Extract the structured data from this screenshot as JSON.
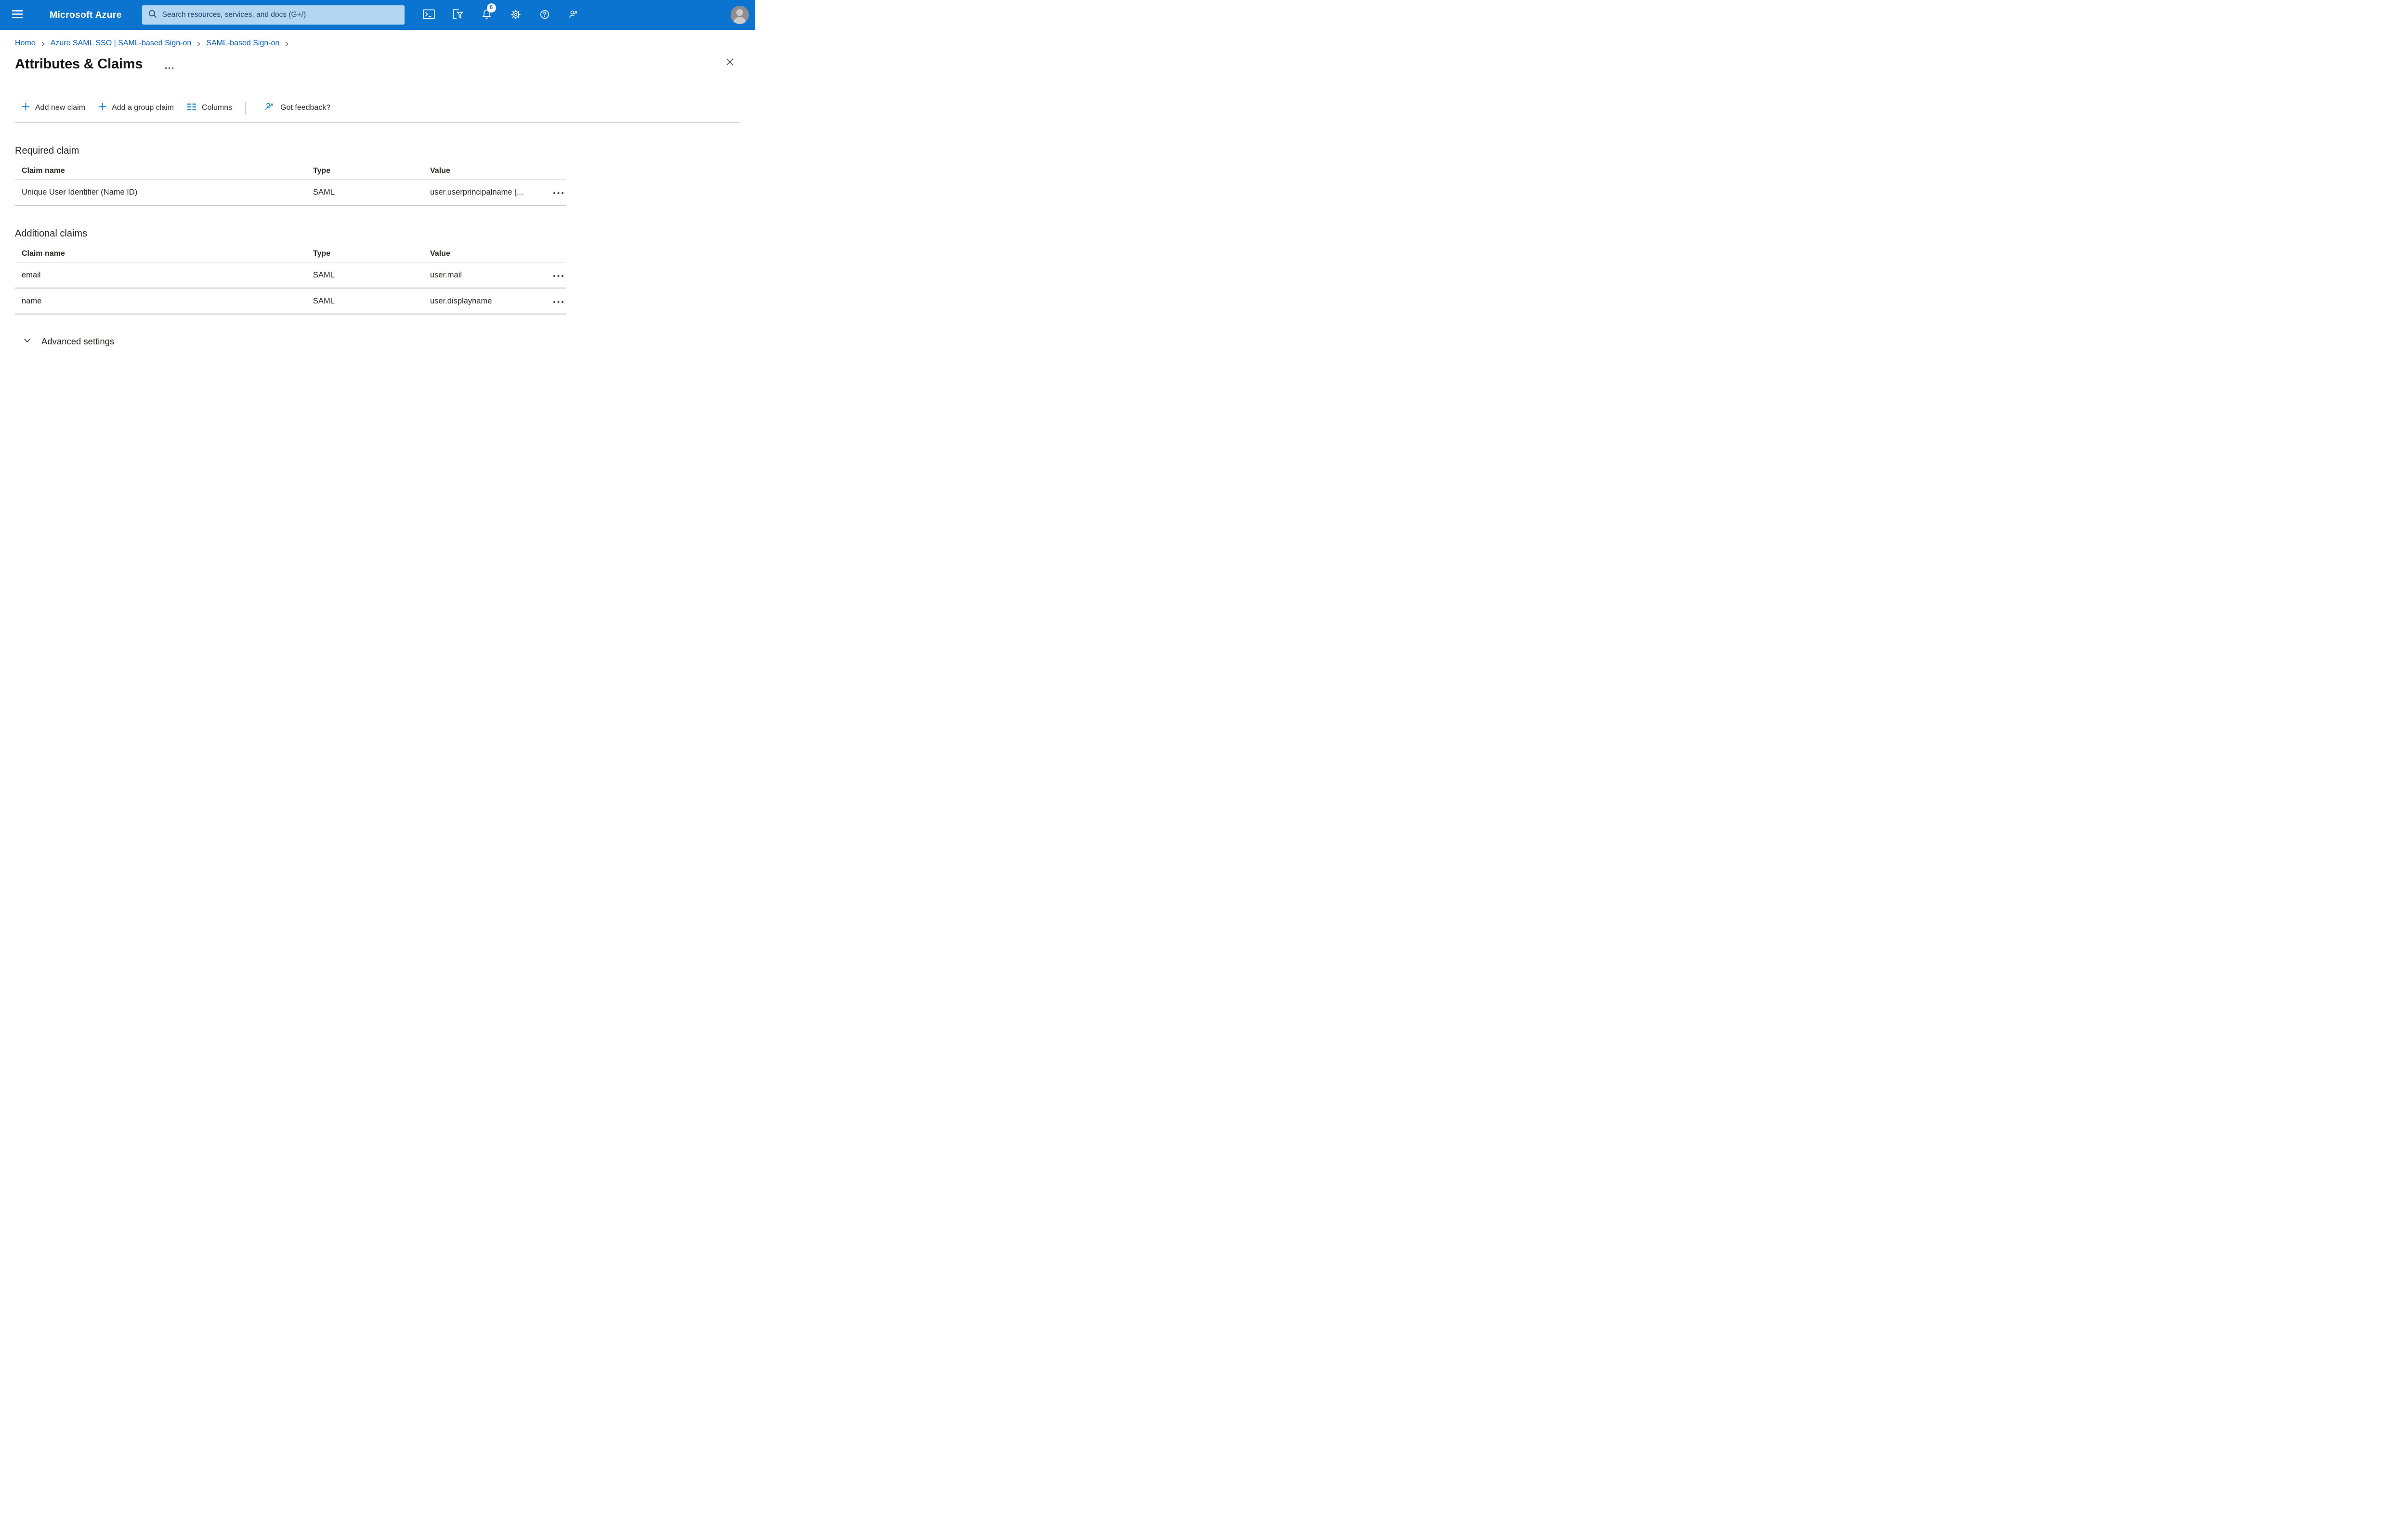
{
  "topbar": {
    "brand": "Microsoft Azure",
    "search": {
      "placeholder": "Search resources, services, and docs (G+/)"
    },
    "notifications_badge": "6"
  },
  "breadcrumb": {
    "items": [
      {
        "label": "Home"
      },
      {
        "label": "Azure SAML SSO | SAML-based Sign-on"
      },
      {
        "label": "SAML-based Sign-on"
      }
    ]
  },
  "page": {
    "title": "Attributes & Claims"
  },
  "toolbar": {
    "add_new_claim": "Add new claim",
    "add_group_claim": "Add a group claim",
    "columns": "Columns",
    "got_feedback": "Got feedback?"
  },
  "required_claim": {
    "heading": "Required claim",
    "columns": {
      "name": "Claim name",
      "type": "Type",
      "value": "Value"
    },
    "rows": [
      {
        "name": "Unique User Identifier (Name ID)",
        "type": "SAML",
        "value": "user.userprincipalname [..."
      }
    ]
  },
  "additional_claims": {
    "heading": "Additional claims",
    "columns": {
      "name": "Claim name",
      "type": "Type",
      "value": "Value"
    },
    "rows": [
      {
        "name": "email",
        "type": "SAML",
        "value": "user.mail"
      },
      {
        "name": "name",
        "type": "SAML",
        "value": "user.displayname"
      }
    ]
  },
  "advanced": {
    "label": "Advanced settings"
  },
  "colors": {
    "topbar_blue": "#0b73d0",
    "search_bg": "#b3d6f2",
    "search_text": "#1d4a70",
    "link_blue": "#015cda",
    "accent_blue": "#0078d4",
    "badge_bg": "#ffffff",
    "badge_text": "#0b73d0"
  },
  "icons": {
    "hamburger": "menu-bars",
    "search": "magnifier",
    "cloud_shell": "terminal-prompt",
    "directory_filter": "page-with-funnel",
    "notifications": "bell",
    "settings": "gear",
    "help": "question-circle",
    "feedback": "person-with-arrow",
    "add": "plus",
    "columns": "two-column-dashes",
    "more_options": "ellipsis-horizontal",
    "close": "x",
    "row_menu": "ellipsis-horizontal",
    "advanced_chevron": "chevron-down",
    "breadcrumb_separator": "chevron-right"
  }
}
